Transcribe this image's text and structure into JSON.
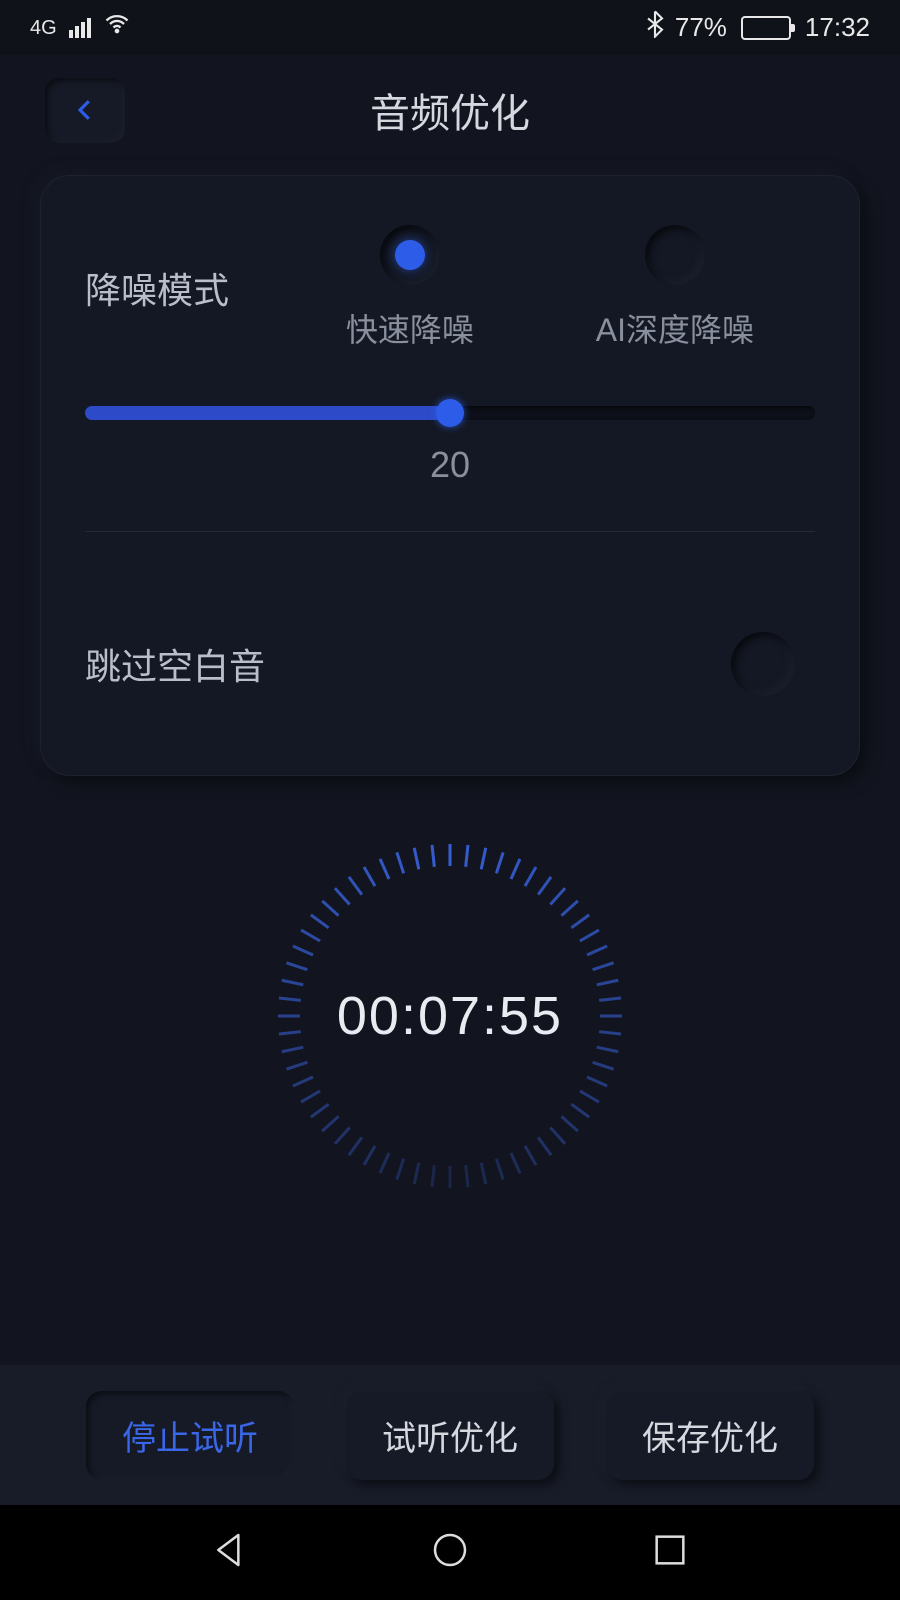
{
  "status": {
    "network_label": "4G",
    "battery_percent": "77%",
    "time": "17:32",
    "bluetooth_icon": "bluetooth"
  },
  "header": {
    "title": "音频优化"
  },
  "settings": {
    "noise_mode_label": "降噪模式",
    "noise_options": {
      "fast": "快速降噪",
      "ai": "AI深度降噪"
    },
    "slider_value": "20",
    "skip_silence_label": "跳过空白音"
  },
  "timer": {
    "display": "00:07:55"
  },
  "actions": {
    "stop_preview": "停止试听",
    "preview_optimize": "试听优化",
    "save_optimize": "保存优化"
  }
}
